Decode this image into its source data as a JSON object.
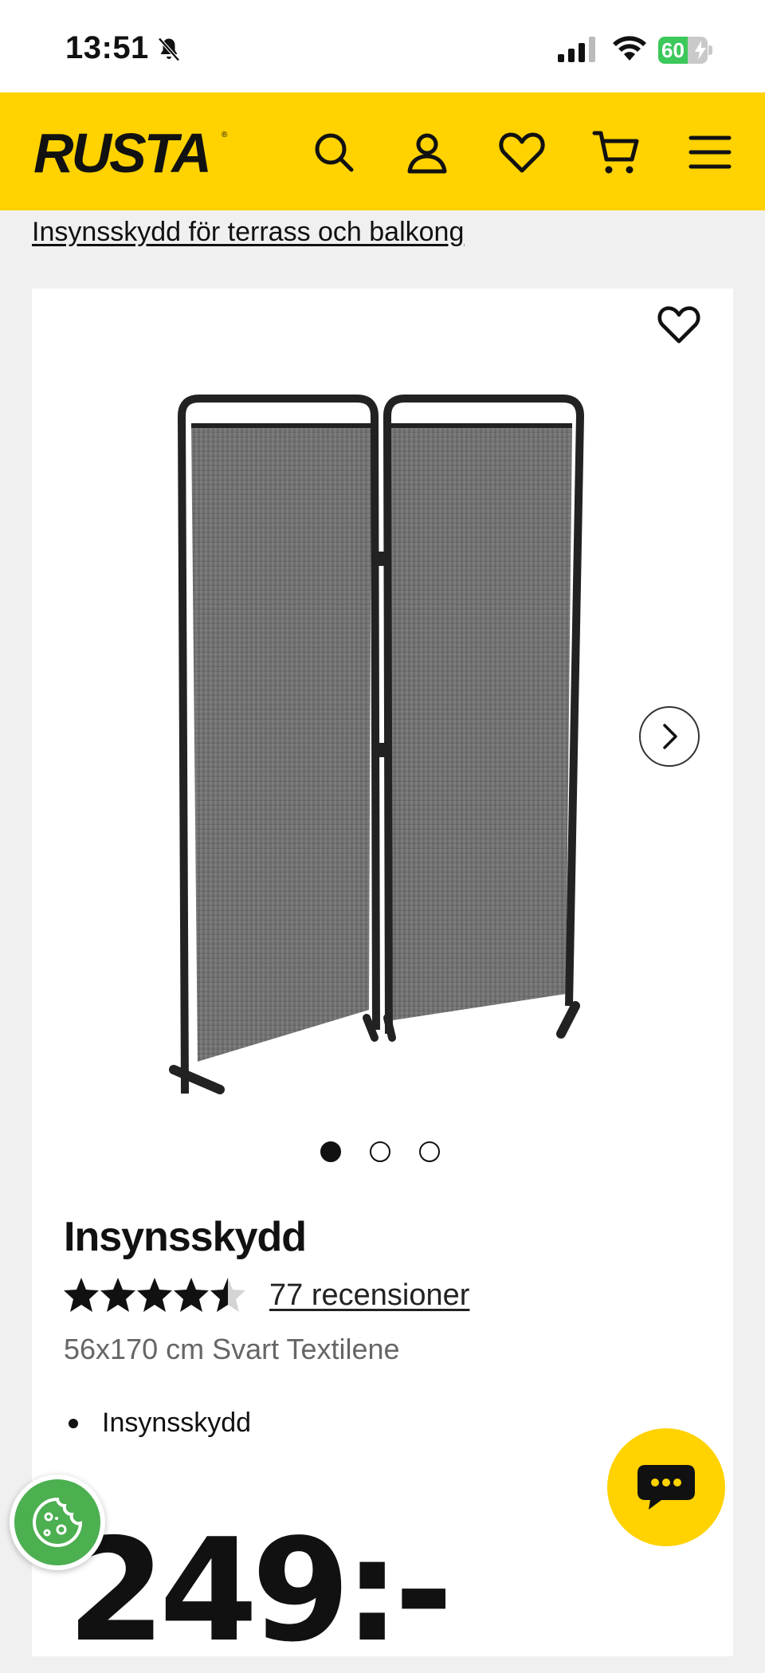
{
  "status_bar": {
    "time": "13:51",
    "battery_percent": "60",
    "battery_level": 0.6,
    "icons": [
      "bell-slash-icon",
      "signal-icon",
      "wifi-icon",
      "battery-charging-icon"
    ]
  },
  "header": {
    "logo_text": "RUSTA",
    "icons": [
      "search-icon",
      "account-icon",
      "wishlist-heart-icon",
      "cart-icon",
      "menu-icon"
    ],
    "colors": {
      "background": "#ffd200",
      "foreground": "#111111"
    }
  },
  "breadcrumb": {
    "label": "Insynsskydd för terrass och balkong"
  },
  "product": {
    "title": "Insynsskydd",
    "rating_value": 4.5,
    "rating_max": 5,
    "reviews_label": "77 recensioner",
    "variant": "56x170 cm Svart Textilene",
    "bullets": [
      "Insynsskydd"
    ],
    "price": "249:-",
    "image_count": 3,
    "active_image": 1
  },
  "floating": {
    "chat_icon": "chat-bubble-icon",
    "cookie_icon": "cookie-icon"
  }
}
